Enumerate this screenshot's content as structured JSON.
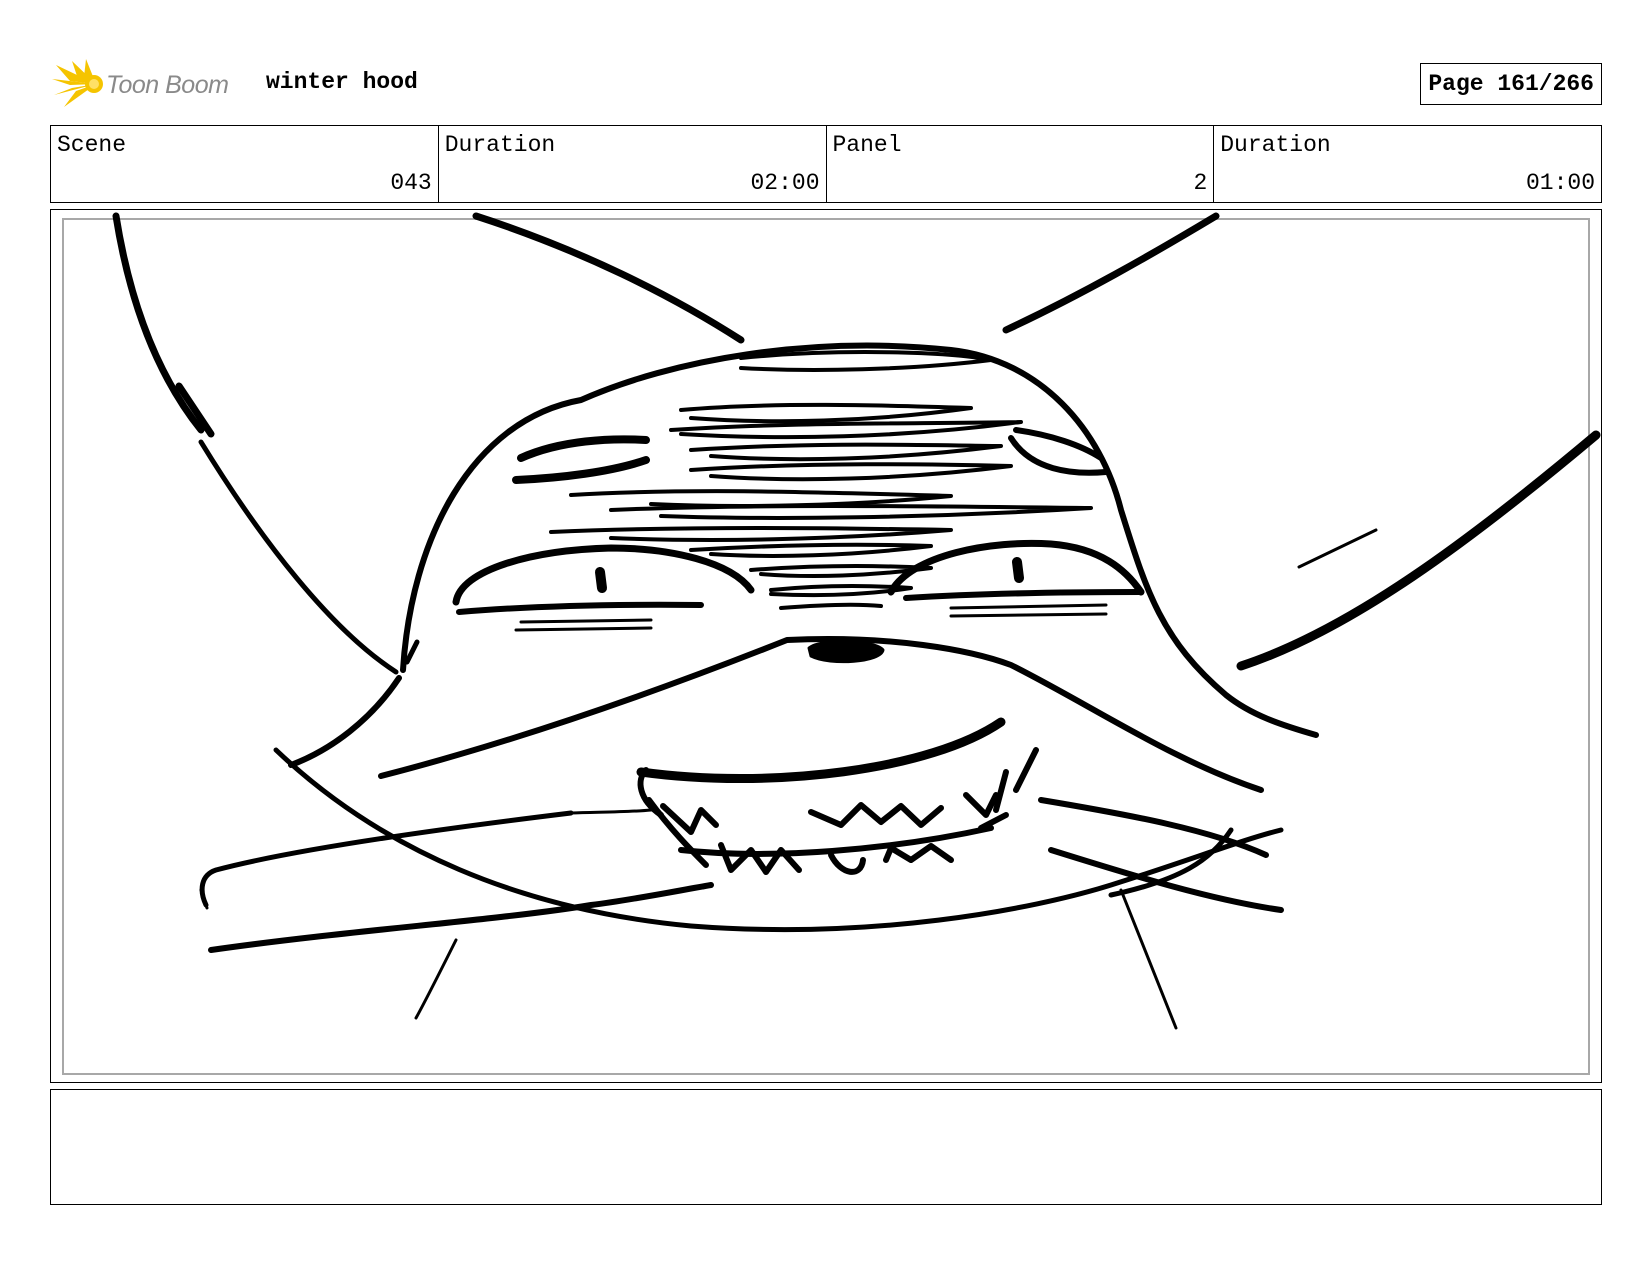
{
  "header": {
    "logo_text": "Toon Boom",
    "project_title": "winter hood",
    "page_label": "Page 161/266"
  },
  "info": {
    "scene_label": "Scene",
    "scene_value": "043",
    "scene_duration_label": "Duration",
    "scene_duration_value": "02:00",
    "panel_label": "Panel",
    "panel_value": "2",
    "panel_duration_label": "Duration",
    "panel_duration_value": "01:00"
  },
  "panel": {
    "image_subject": "rough sketch of a grinning cat face close-up"
  },
  "notes": {
    "text": ""
  },
  "colors": {
    "logo_accent": "#f5c400",
    "logo_text": "#8a8a8a",
    "inner_border": "#a8a8a8"
  }
}
